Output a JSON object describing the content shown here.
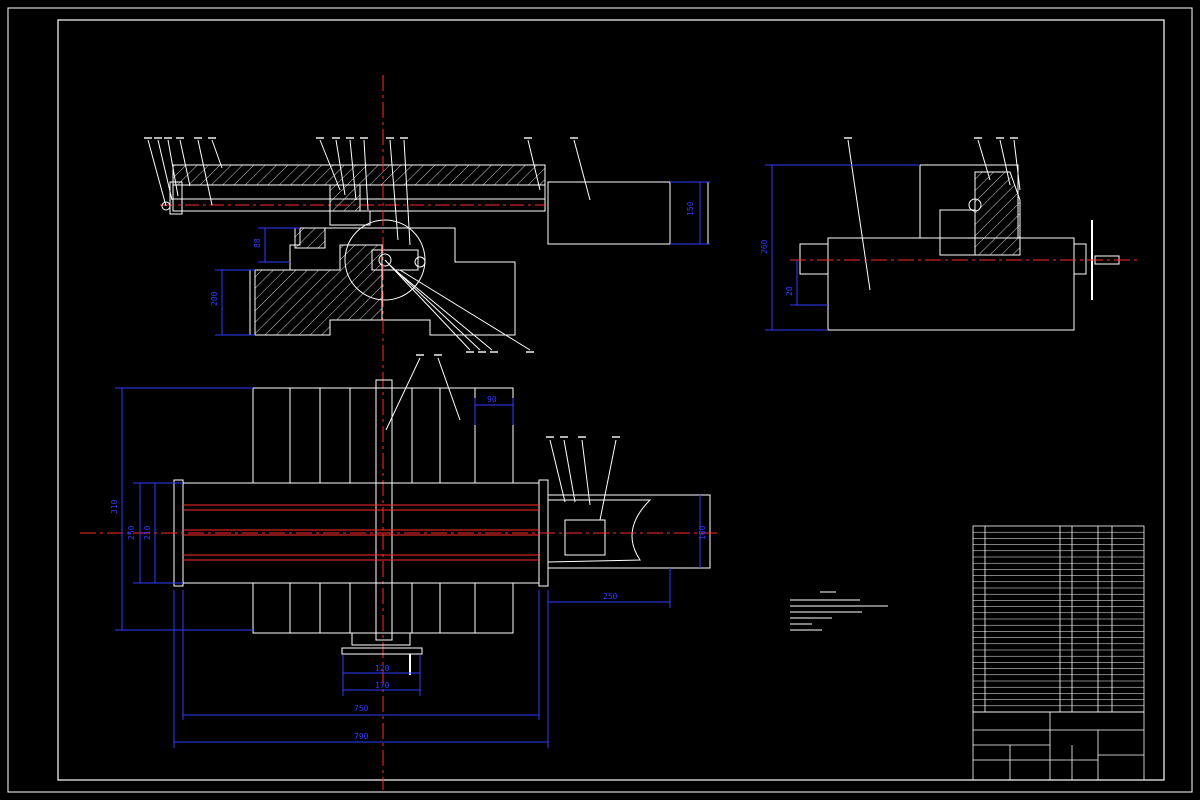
{
  "dimensions": {
    "front_height": "150",
    "front_step": "88",
    "front_base": "200",
    "side_total": "260",
    "side_small": "20",
    "plan_top_width": "90",
    "plan_total_h": "310",
    "plan_mid1": "250",
    "plan_mid2": "210",
    "plan_motor_h": "160",
    "plan_motor_len": "250",
    "plan_handle1": "120",
    "plan_handle2": "170",
    "plan_table_len": "750",
    "plan_overall_len": "790"
  },
  "colors": {
    "background": "#000000",
    "outline": "#ffffff",
    "dimension": "#2f3bff",
    "centerline": "#ff2a2a",
    "hatch": "#ffffff",
    "highlight": "#ffff33"
  }
}
